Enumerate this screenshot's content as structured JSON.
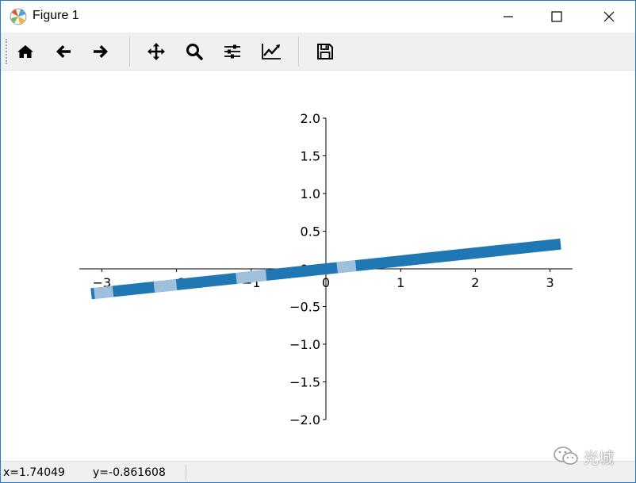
{
  "window": {
    "title": "Figure 1"
  },
  "toolbar": {
    "buttons": [
      {
        "name": "home-icon",
        "tooltip": "Home"
      },
      {
        "name": "back-arrow-icon",
        "tooltip": "Back"
      },
      {
        "name": "forward-arrow-icon",
        "tooltip": "Forward"
      },
      {
        "name": "pan-move-icon",
        "tooltip": "Pan"
      },
      {
        "name": "zoom-magnifier-icon",
        "tooltip": "Zoom"
      },
      {
        "name": "subplots-sliders-icon",
        "tooltip": "Subplots"
      },
      {
        "name": "edit-axes-chart-icon",
        "tooltip": "Customize"
      },
      {
        "name": "save-floppy-icon",
        "tooltip": "Save"
      }
    ]
  },
  "status": {
    "x_readout": "x=1.74049",
    "y_readout": "y=-0.861608"
  },
  "watermark": {
    "text": "光城"
  },
  "colors": {
    "line": "#1f77b4",
    "line_light": "#b3cde3",
    "accent_border": "#2b79c9",
    "toolbar_bg": "#f0f0f0"
  },
  "chart_data": {
    "type": "line",
    "title": "",
    "xlabel": "",
    "ylabel": "",
    "spines": "centered-at-origin",
    "xlim": [
      -3.3,
      3.3
    ],
    "ylim": [
      -2.0,
      2.0
    ],
    "x_ticks": [
      -3,
      -2,
      -1,
      0,
      1,
      2,
      3
    ],
    "x_tick_labels": [
      "−3",
      "−2",
      "−1",
      "0",
      "1",
      "2",
      "3"
    ],
    "y_ticks": [
      2.0,
      1.5,
      1.0,
      0.5,
      0.0,
      -0.5,
      -1.0,
      -1.5,
      -2.0
    ],
    "y_tick_labels": [
      "2.0",
      "1.5",
      "1.0",
      "0.5",
      "0.0",
      "−0.5",
      "−1.0",
      "−1.5",
      "−2.0"
    ],
    "series": [
      {
        "x": [
          -3.1416,
          3.1416
        ],
        "y": [
          -0.33,
          0.33
        ]
      }
    ],
    "light_segments_x": [
      [
        -3.1,
        -2.85
      ],
      [
        -2.3,
        -2.0
      ],
      [
        -1.2,
        -0.8
      ],
      [
        0.15,
        0.4
      ]
    ]
  }
}
